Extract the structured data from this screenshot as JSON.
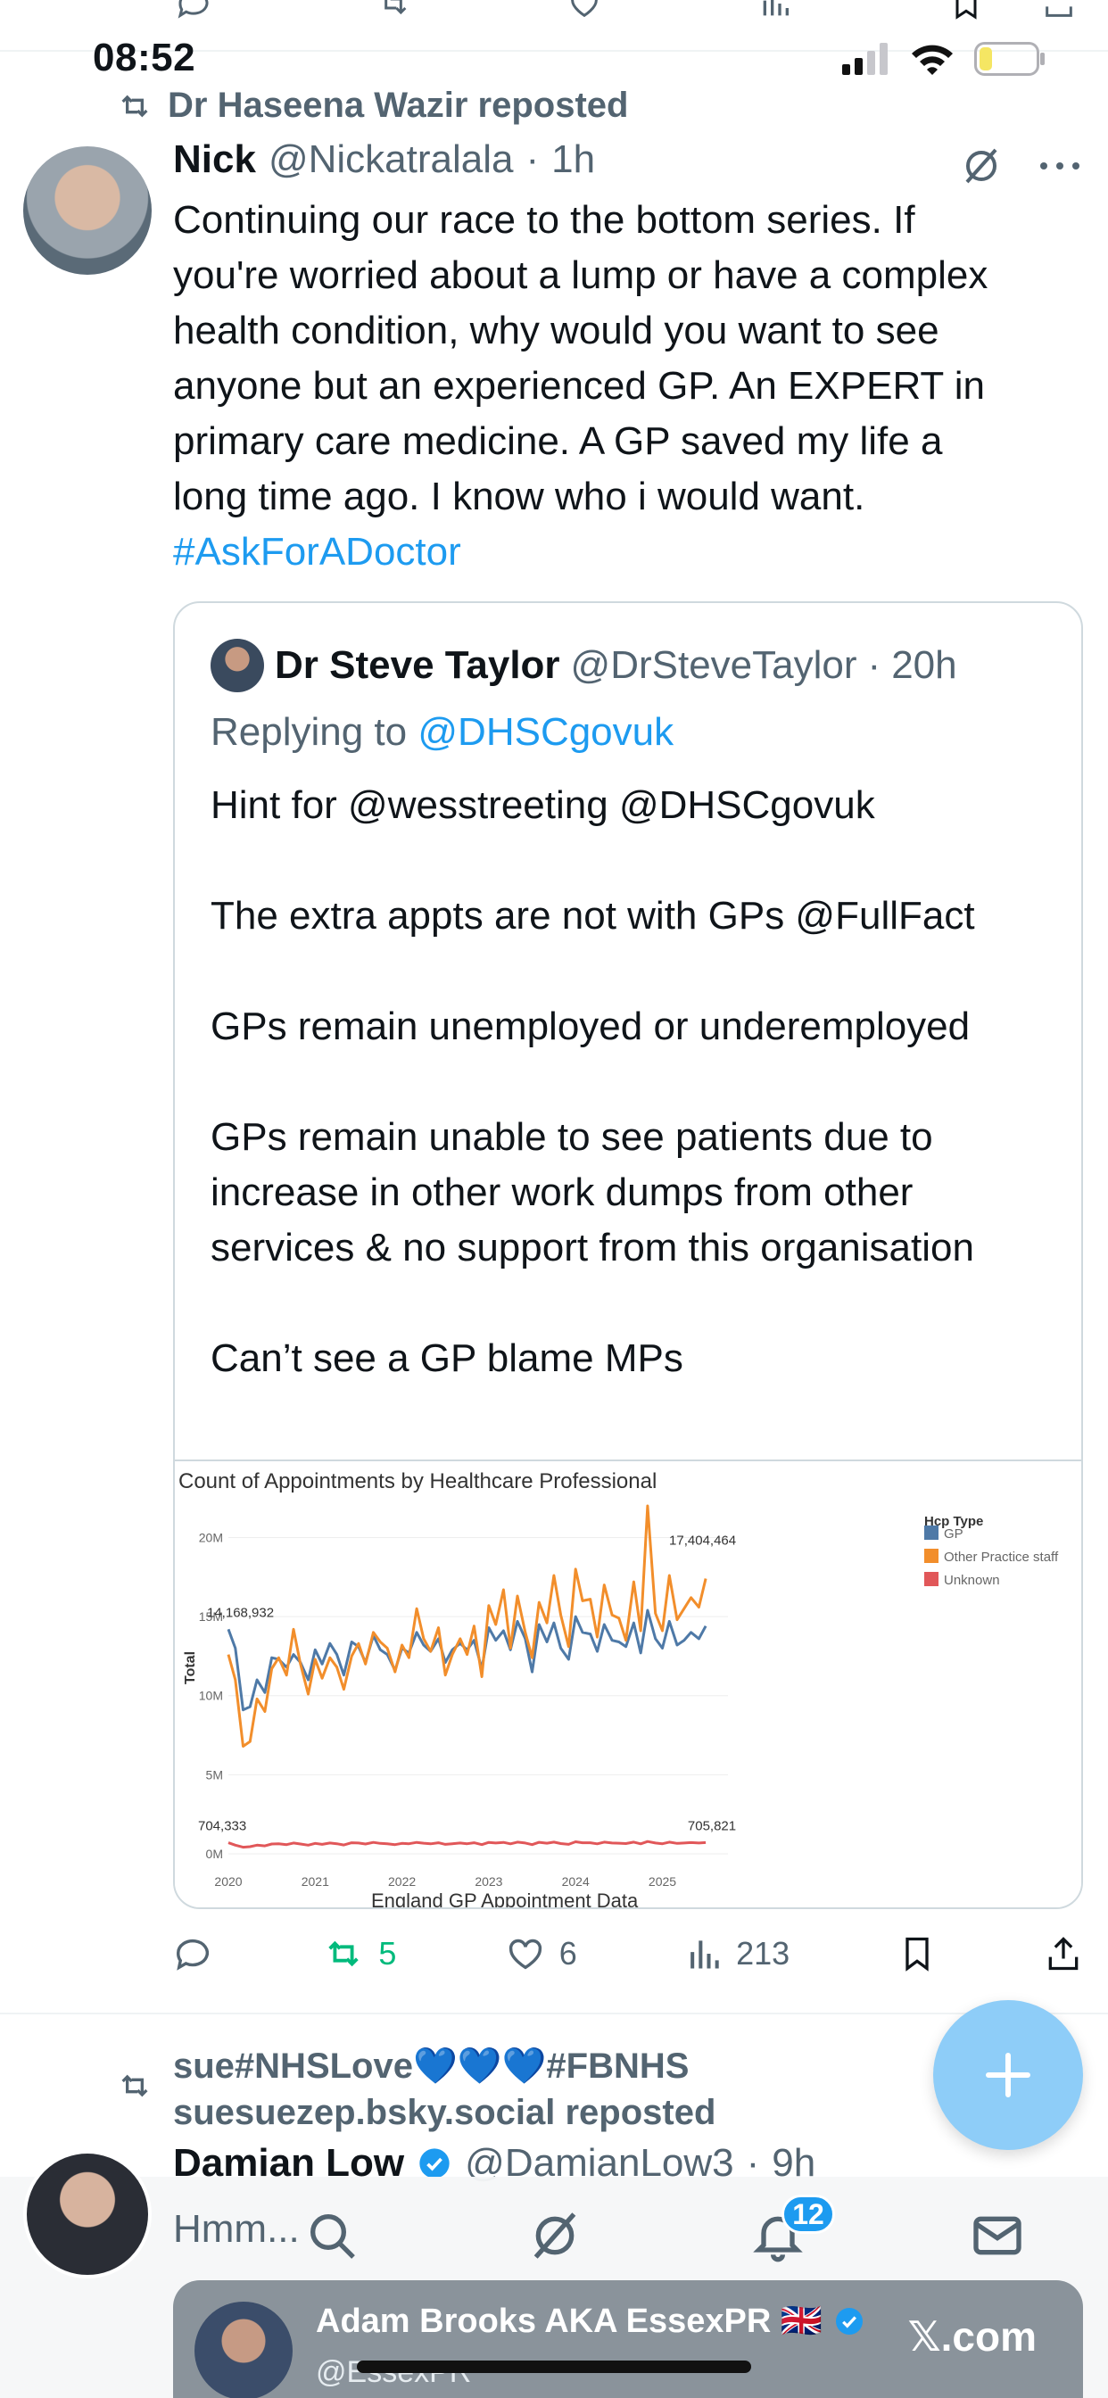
{
  "status_bar": {
    "time": "08:52"
  },
  "tweet": {
    "reposted_by": "Dr Haseena Wazir reposted",
    "author_name": "Nick",
    "author_handle": "@Nickatralala",
    "dot": "·",
    "time": "1h",
    "text_lines": [
      "Continuing our race to the bottom series. If",
      "you're worried about a lump or have a complex",
      "health condition, why would you want to see",
      "anyone but an experienced GP. An EXPERT in",
      "primary care medicine. A GP saved my life a",
      "long time ago. I know who i would want."
    ],
    "hashtag": "#AskForADoctor",
    "quote": {
      "author_name": "Dr Steve Taylor",
      "author_handle": "@DrSteveTaylor",
      "dot": "·",
      "time": "20h",
      "replying_prefix": "Replying to",
      "replying_to": "@DHSCgovuk",
      "paragraphs": [
        "Hint for @wesstreeting @DHSCgovuk",
        "The extra appts are not with GPs @FullFact",
        "GPs remain unemployed or underemployed",
        "GPs remain unable to see patients due to increase in other work dumps from other services & no support from this organisation",
        "Can’t see a GP blame MPs"
      ]
    },
    "actions": {
      "reposts": "5",
      "likes": "6",
      "views": "213"
    }
  },
  "chart_data": {
    "type": "line",
    "title": "Count of Appointments by Healthcare Professional",
    "subtitle": "England GP Appointment Data",
    "xlabel": "",
    "ylabel": "Total",
    "y_tick_labels": [
      "0M",
      "5M",
      "10M",
      "15M",
      "20M"
    ],
    "x_tick_labels": [
      "2020",
      "2021",
      "2022",
      "2023",
      "2024",
      "2025"
    ],
    "ylim": [
      0,
      22000000
    ],
    "xlim": [
      2020,
      2025.55
    ],
    "legend_title": "Hcp Type",
    "legend_position": "top-right",
    "grid": true,
    "annotations": [
      "14,168,932",
      "17,404,464",
      "704,333",
      "705,821"
    ],
    "x": [
      2020.0,
      2020.08,
      2020.17,
      2020.25,
      2020.33,
      2020.42,
      2020.5,
      2020.58,
      2020.67,
      2020.75,
      2020.83,
      2020.92,
      2021.0,
      2021.08,
      2021.17,
      2021.25,
      2021.33,
      2021.42,
      2021.5,
      2021.58,
      2021.67,
      2021.75,
      2021.83,
      2021.92,
      2022.0,
      2022.08,
      2022.17,
      2022.25,
      2022.33,
      2022.42,
      2022.5,
      2022.58,
      2022.67,
      2022.75,
      2022.83,
      2022.92,
      2023.0,
      2023.08,
      2023.17,
      2023.25,
      2023.33,
      2023.42,
      2023.5,
      2023.58,
      2023.67,
      2023.75,
      2023.83,
      2023.92,
      2024.0,
      2024.08,
      2024.17,
      2024.25,
      2024.33,
      2024.42,
      2024.5,
      2024.58,
      2024.67,
      2024.75,
      2024.83,
      2024.92,
      2025.0,
      2025.08,
      2025.17,
      2025.25,
      2025.33,
      2025.42,
      2025.5
    ],
    "series": [
      {
        "name": "GP",
        "color": "#4e79a7",
        "values": [
          14.2,
          13.0,
          9.1,
          9.3,
          11.0,
          10.2,
          12.4,
          12.3,
          11.8,
          12.6,
          12.1,
          11.0,
          12.9,
          12.0,
          13.3,
          12.6,
          11.3,
          13.4,
          13.1,
          12.1,
          13.8,
          12.9,
          12.6,
          11.6,
          13.0,
          12.7,
          14.0,
          13.2,
          12.8,
          13.6,
          12.1,
          12.9,
          13.3,
          12.9,
          13.5,
          11.7,
          14.3,
          13.5,
          14.1,
          12.9,
          14.7,
          13.6,
          11.5,
          14.5,
          13.4,
          14.6,
          13.0,
          12.3,
          15.0,
          14.0,
          13.9,
          12.8,
          14.5,
          13.5,
          13.4,
          13.1,
          14.6,
          12.7,
          15.4,
          13.6,
          13.0,
          14.7,
          13.2,
          13.5,
          14.0,
          13.6,
          14.4
        ]
      },
      {
        "name": "Other Practice staff",
        "color": "#f28e2b",
        "values": [
          12.6,
          11.0,
          6.8,
          7.1,
          9.8,
          9.0,
          11.7,
          12.4,
          11.3,
          14.2,
          12.0,
          10.1,
          12.3,
          11.1,
          12.4,
          11.8,
          10.4,
          12.5,
          13.3,
          12.0,
          14.0,
          13.4,
          13.0,
          11.5,
          13.2,
          12.4,
          15.5,
          13.6,
          12.8,
          14.3,
          11.3,
          12.6,
          13.6,
          12.6,
          14.4,
          11.2,
          15.7,
          14.5,
          16.7,
          13.0,
          16.3,
          14.0,
          12.4,
          15.9,
          14.6,
          17.6,
          15.1,
          13.1,
          18.0,
          16.0,
          16.1,
          13.7,
          17.0,
          15.1,
          14.9,
          13.5,
          17.2,
          14.1,
          22.0,
          15.2,
          14.1,
          17.6,
          14.8,
          15.5,
          16.2,
          15.6,
          17.4
        ]
      },
      {
        "name": "Unknown",
        "color": "#e15759",
        "values": [
          0.7,
          0.55,
          0.42,
          0.45,
          0.55,
          0.5,
          0.62,
          0.64,
          0.58,
          0.68,
          0.62,
          0.55,
          0.66,
          0.6,
          0.68,
          0.64,
          0.56,
          0.7,
          0.68,
          0.62,
          0.72,
          0.66,
          0.64,
          0.58,
          0.66,
          0.64,
          0.72,
          0.67,
          0.63,
          0.7,
          0.6,
          0.64,
          0.68,
          0.64,
          0.7,
          0.58,
          0.72,
          0.68,
          0.72,
          0.63,
          0.74,
          0.68,
          0.58,
          0.73,
          0.67,
          0.74,
          0.65,
          0.6,
          0.76,
          0.7,
          0.7,
          0.63,
          0.74,
          0.68,
          0.67,
          0.65,
          0.74,
          0.63,
          0.78,
          0.68,
          0.64,
          0.74,
          0.66,
          0.68,
          0.71,
          0.68,
          0.71
        ]
      }
    ],
    "value_scale": "millions"
  },
  "next_tweet": {
    "reposted_by_line1": "sue#NHSLove💙💙💙#FBNHS",
    "reposted_by_line2": "suesuezep.bsky.social reposted",
    "author_name": "Damian Low",
    "author_handle": "@DamianLow3",
    "dot": "·",
    "time": "9h"
  },
  "bottom_nav": {
    "compose_placeholder": "Hmm...",
    "notifications_count": "12"
  },
  "promo": {
    "name": "Adam Brooks AKA EssexPR 🇬🇧",
    "handle": "@EssexPR",
    "site": "𝕏.com"
  },
  "colors": {
    "accent": "#1d9bf0",
    "repost_green": "#00ba7c",
    "muted": "#536471",
    "fab": "#8ecdf8"
  }
}
